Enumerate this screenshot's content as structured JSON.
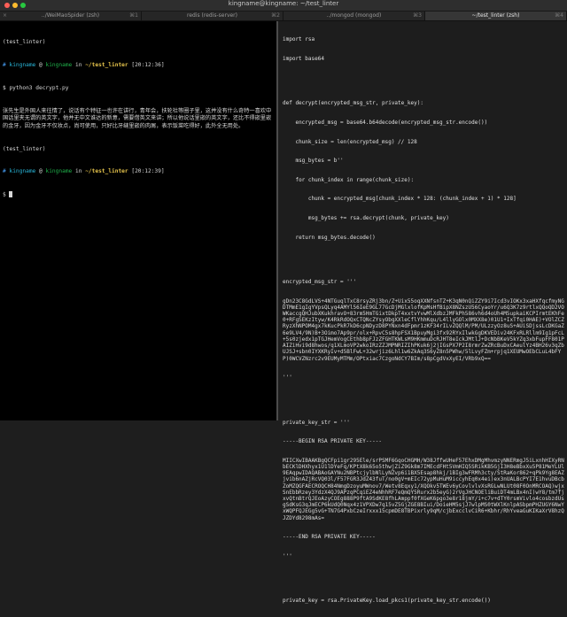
{
  "window": {
    "title": "kingname@kingname: ~/test_linter"
  },
  "tabs": [
    {
      "close": "×",
      "label": "../WeiMaoSpider (zsh)",
      "shortcut": "⌘1",
      "active": false
    },
    {
      "close": "",
      "label": "redis (redis-server)",
      "shortcut": "⌘2",
      "active": false
    },
    {
      "close": "",
      "label": "../mongod (mongod)",
      "shortcut": "⌘3",
      "active": false
    },
    {
      "close": "",
      "label": "~/test_linter (zsh)",
      "shortcut": "⌘4",
      "active": true
    }
  ],
  "left": {
    "top_line": "(test_linter)",
    "prompt1": {
      "hash": "#",
      "user": "kingname",
      "at": " @ ",
      "host": "kingname",
      "in": " in ",
      "path": "~/test_linter",
      "time": " [20:12:36]"
    },
    "cmd": "$ python3 decrypt.py",
    "output": "张先生是外国人来往情了，说话有个特征一也许在讲行，青年会，扶轮社等圈子里，这并没有什么奇特一喜欢中国话里夹无谓的英文字，他并无中文谁达的新意，需要借英文来讲；所以他说话里嵌的英文字，还比不得嵌里嵌的金牙，因为金牙不仅妆点，尚可使用，只好比牙缝里嵌的肉屑，表示饭菜吃得好，此外全无用处。",
    "env2": "(test_linter)",
    "prompt2": {
      "hash": "#",
      "user": "kingname",
      "at": " @ ",
      "host": "kingname",
      "in": " in ",
      "path": "~/test_linter",
      "time": " [20:12:39]"
    },
    "cmd2": "$ "
  },
  "right": {
    "imports": [
      "import rsa",
      "import base64"
    ],
    "func": [
      "def decrypt(encrypted_msg_str, private_key):",
      "    encrypted_msg = base64.b64decode(encrypted_msg_str.encode())",
      "    chunk_size = len(encrypted_msg) // 128",
      "    msg_bytes = b''",
      "    for chunk_index in range(chunk_size):",
      "        chunk = encrypted_msg[chunk_index * 128: (chunk_index + 1) * 128]",
      "        msg_bytes += rsa.decrypt(chunk, private_key)",
      "    return msg_bytes.decode()"
    ],
    "enc_label": "encrypted_msg_str = '''",
    "enc_body": "gDn23C8GdLVS+4NTGuqlTxC8rsyZRj3bn/Z+Uix55oqXXNfsnTZ+K3qN0nQiZZY9i7Icd3vIOKx3xaHXfqcfmyNGDTMmE1gIgYVpsQLyq4AMYl56IeE9GL77GcDjMGlxlofKpMsHfBipX8NZszU56CyaoYr/u6Q3K7z9rtlxQQoQD2VOWKaccgQHJubXKukhravO+83rm5HmTGixtDkpT4xxtvYvwMlXdbzJMFkPh586vh6d4oUh4M5upkaiKCPIrmtEKhFe0+RFgSEKzItyw/K4RkRdOQxCTQNcZYsyObgXXleCflYhhKqu/L4llyGOlx0MXX8e)01U1+IxTfqi0HAE)+VOlZCZRyzXhNPOM4gx7kKucPkR7kD6cpNDyzD8PYNxn4dFpmr1zKF34rILvZQQlM/PM/ULzzyOz8uS+AUiSDjssLcDKGaZ6e9LV4/9N)B+3Oimo7Ap9pr/olx+RpvC5s8hpFSX1BpuyMgi3fx92RYxIlwkGgDKVEDiv24KFxRLRllm9Ig1pFcL+5s0zjedx1pTGJHemVogCEthb8pFJzZFGHTKWLsM9HKmmuDcRJHT8eIckJMtlJ+DcNbBKeV5kYZq3xbFupFF801PAIZiHvi9d8hwos/q1XLmoVP2wkoIRzZZJMPNRIZIhPKuk6j2jIGsPX7P2I8rmrZwZRcBuDxCAeulYz4BH26v3qZbUJSJ+sbn0IYXKRyIv+d5BlFwL+32wrjiz6Lhl1w6ZkAq3S6yZ8n5PWhw/5lLvyFZm+rpjq1XEUMwOEbCLuL4bFYP)0WCVZNzrc2v9EUMyMTMm/OPtxiac7CzgoNdCY7BIm/s8pCgdVxXyEI/VRb9xQ==",
    "enc_end": "'''",
    "pk_label": "private_key_str = '''",
    "pk_begin": "-----BEGIN RSA PRIVATE KEY-----",
    "pk_body": "MIICXwIBAAKBgQCFpi1gr295Ele/srPSMF6GqoCHGMH/W38JffwUHeF57EhxDMgMhvmzyNNERmgJ5iLxnhHIXyRNbECKlDHXhyx1U1lDYeFq/KPtX8k65o5thwjZiZ9Gk8m7IMEcdFHt5VmHIQ5SRikKB5GjI3H8eBbxXu5P81MeYLUl9EAqpwIDAQABAoGAYNu2NBPtcjylbNlLyNZvp6i1BX5Esap8hkj/1BIg3wFRMh3cty/StRaKor862+qPk9Yg8EAZjvib6nAZjRcVQ03l/F57FGR3JdZ43fuT/no0gV+mEIc72ypMuHuM9iccyhEq0x4ei)ex3nUALBcPYI7E1hvuDBcbZoMZQGFAECROQCH84NmgDzoyuMWnov7/Wetv8Eqxy1/XQOkv5TWEv6yCovlvlvXsRGLwNLUt08F0OnMRCOAQ)wjxSnEbbRzey3YdzX4QJ9APzqPCqiEZ4eNhhRF7eQmQY5Rurx2b5eyG)2rVgJHCNOEliBuiDT4mLBx4nI)wY8/tm7fjxvQtnBtrQJEoAzyCOEg888P9ftA9SdKE8fhLAmppf0fXGeK6pgo3e8r18jmY/i+c7v+dTY0rsmVivlo4cosbzdUsgSdKsG3qJmECP6kUdQ0Nqx4z1VPXDw7q15vZ5GjZGE8BIui/DoieHM5sjJ7wlpMS0tWXlKnlpASbpmPHZUGY6NwYxWQPFQJEGg5vG+TN7G4PxbCzeIrxxx15cpmDE8TBPixrly9qM/cjbExcclvCiR6+Kbhr/RhYveaGuKIKaXrV8hzQJZDYd8298mAs=",
    "pk_end": "-----END RSA PRIVATE KEY-----",
    "pk_close": "'''",
    "last_line": "private_key = rsa.PrivateKey.load_pkcs1(private_key_str.encode())"
  }
}
